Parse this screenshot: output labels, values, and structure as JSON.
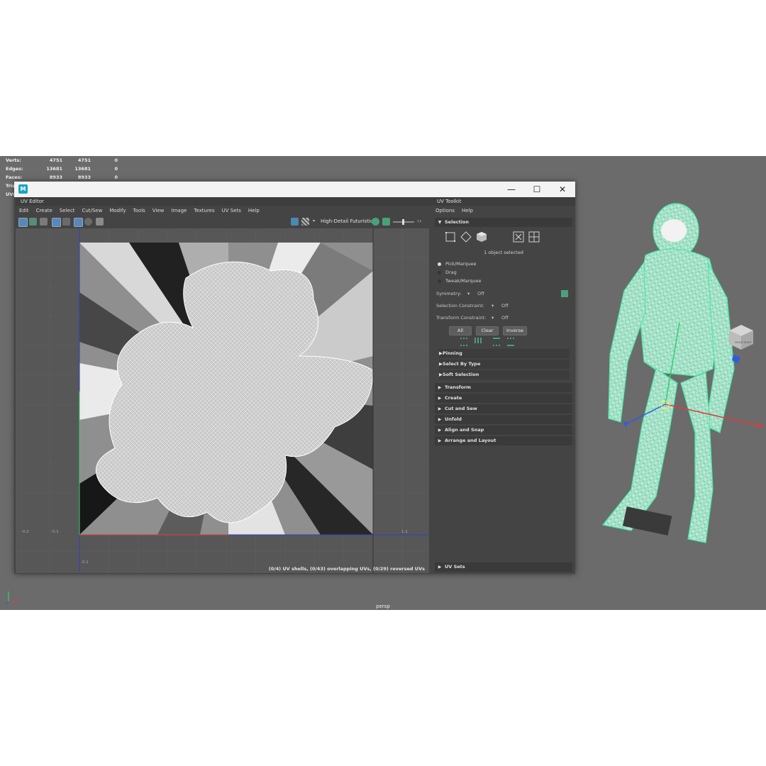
{
  "hud": {
    "rows": [
      {
        "label": "Verts:",
        "v1": "4751",
        "v2": "4751",
        "v3": "0"
      },
      {
        "label": "Edges:",
        "v1": "13681",
        "v2": "13681",
        "v3": "0"
      },
      {
        "label": "Faces:",
        "v1": "8933",
        "v2": "8933",
        "v3": "0"
      },
      {
        "label": "Tris:",
        "v1": "",
        "v2": "",
        "v3": ""
      },
      {
        "label": "UVs:",
        "v1": "",
        "v2": "",
        "v3": ""
      }
    ]
  },
  "viewport": {
    "camera_label": "persp",
    "viewcube_faces": [
      "FRONT",
      "RIGHT"
    ],
    "mesh_color": "#4de8a8",
    "background": "#6b6b6b"
  },
  "window": {
    "controls": {
      "minimize": "—",
      "maximize": "☐",
      "close": "✕"
    }
  },
  "uv_editor": {
    "title": "UV Editor",
    "menu": [
      "Edit",
      "Create",
      "Select",
      "Cut/Sew",
      "Modify",
      "Tools",
      "View",
      "Image",
      "Textures",
      "UV Sets",
      "Help"
    ],
    "material": "High-Detail Futuristic",
    "axis_labels": {
      "left1": "-0.2",
      "left2": "-0.1",
      "right": "1.1",
      "bottom": "-0.1"
    },
    "status": "(0/4) UV shells, (0/43) overlapping UVs, (0/29) reversed UVs"
  },
  "uv_toolkit": {
    "title": "UV Toolkit",
    "menu": [
      "Options",
      "Help"
    ],
    "selection": {
      "header": "Selection",
      "count_text": "1 object selected",
      "modes": [
        {
          "label": "Pick/Marquee",
          "selected": true
        },
        {
          "label": "Drag",
          "selected": false
        },
        {
          "label": "Tweak/Marquee",
          "selected": false
        }
      ],
      "symmetry_label": "Symmetry:",
      "symmetry_value": "Off",
      "constraint_label": "Selection Constraint:",
      "constraint_value": "Off",
      "transform_label": "Transform Constraint:",
      "transform_value": "Off",
      "buttons": {
        "all": "All",
        "clear": "Clear",
        "inverse": "Inverse"
      },
      "subsections": [
        "Pinning",
        "Select By Type",
        "Soft Selection"
      ]
    },
    "sections": [
      "Transform",
      "Create",
      "Cut and Sew",
      "Unfold",
      "Align and Snap",
      "Arrange and Layout"
    ],
    "uv_sets": "UV Sets"
  }
}
